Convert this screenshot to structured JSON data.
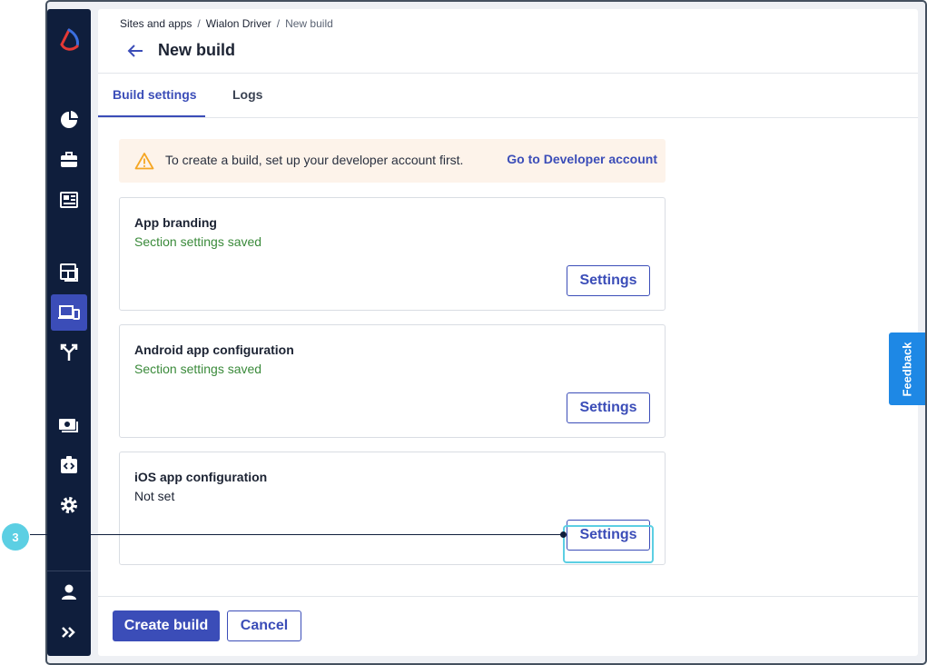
{
  "breadcrumb": {
    "items": [
      "Sites and apps",
      "Wialon Driver",
      "New build"
    ],
    "separator": "/"
  },
  "page": {
    "title": "New build"
  },
  "tabs": [
    {
      "label": "Build settings",
      "active": true
    },
    {
      "label": "Logs",
      "active": false
    }
  ],
  "alert": {
    "message": "To create a build, set up your developer account first.",
    "link": "Go to Developer account"
  },
  "sections": [
    {
      "title": "App branding",
      "status": "Section settings saved",
      "button": "Settings"
    },
    {
      "title": "Android app configuration",
      "status": "Section settings saved",
      "button": "Settings"
    },
    {
      "title": "iOS app configuration",
      "status": "Not set",
      "button": "Settings"
    }
  ],
  "footer": {
    "create_label": "Create build",
    "cancel_label": "Cancel"
  },
  "feedback": {
    "label": "Feedback"
  },
  "callout": {
    "number": "3"
  },
  "sidebar": {
    "icons": [
      "logo-icon",
      "pie-chart-icon",
      "briefcase-icon",
      "dashboard-icon",
      "layout-icon",
      "devices-icon",
      "merge-icon",
      "money-icon",
      "code-icon",
      "gear-icon",
      "user-icon",
      "expand-icon"
    ],
    "active": "devices-icon"
  },
  "colors": {
    "accent": "#3b4db8",
    "sidebar": "#0f1e3c",
    "success": "#3a8a3a",
    "warning_bg": "#fdf3ea",
    "warning_icon": "#f5a623",
    "feedback": "#1e88e5",
    "callout": "#5ccfe3"
  }
}
